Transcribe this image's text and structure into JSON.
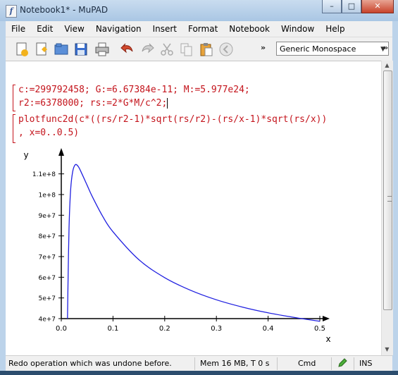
{
  "window": {
    "title": "Notebook1* - MuPAD",
    "app_icon_glyph": "f"
  },
  "menubar": {
    "items": [
      "File",
      "Edit",
      "View",
      "Navigation",
      "Insert",
      "Format",
      "Notebook",
      "Window",
      "Help"
    ]
  },
  "toolbar": {
    "buttons": [
      "new-notebook-icon",
      "new-editor-icon",
      "open-icon",
      "save-icon",
      "print-icon",
      "undo-icon",
      "redo-icon",
      "cut-icon",
      "copy-icon",
      "paste-icon",
      "stop-icon"
    ],
    "overflow_left": "»",
    "font_select": "Generic Monospace",
    "overflow_right": "»"
  },
  "notebook": {
    "input1": {
      "line1": "c:=299792458; G:=6.67384e-11; M:=5.977e24;",
      "line2": "r2:=6378000; rs:=2*G*M/c^2;"
    },
    "input2": {
      "line1": "plotfunc2d(c*((rs/r2-1)*sqrt(rs/r2)-(rs/x-1)*sqrt(rs/x))",
      "line2": ", x=0..0.5)"
    }
  },
  "chart_data": {
    "type": "line",
    "xlabel": "x",
    "ylabel": "y",
    "xlim": [
      0,
      0.5
    ],
    "ylim": [
      40000000,
      115000000
    ],
    "x_ticks": [
      "0.0",
      "0.1",
      "0.2",
      "0.3",
      "0.4",
      "0.5"
    ],
    "x_tick_values": [
      0,
      0.1,
      0.2,
      0.3,
      0.4,
      0.5
    ],
    "y_ticks": [
      "4e+7",
      "5e+7",
      "6e+7",
      "7e+7",
      "8e+7",
      "9e+7",
      "1e+8",
      "1.1e+8"
    ],
    "y_tick_values": [
      40000000,
      50000000,
      60000000,
      70000000,
      80000000,
      90000000,
      100000000,
      110000000
    ],
    "series": [
      {
        "color": "#1f1fe0",
        "x": [
          0.012,
          0.013,
          0.015,
          0.018,
          0.022,
          0.027,
          0.033,
          0.04,
          0.05,
          0.06,
          0.08,
          0.1,
          0.15,
          0.2,
          0.25,
          0.3,
          0.35,
          0.4,
          0.45,
          0.5
        ],
        "y": [
          40000000,
          57000000,
          84000000,
          102000000,
          111000000,
          114400000,
          113500000,
          110000000,
          104500000,
          99000000,
          89500000,
          82000000,
          68500000,
          59800000,
          53700000,
          49100000,
          45600000,
          42800000,
          40600000,
          38700000
        ]
      }
    ]
  },
  "statusbar": {
    "message": "Redo operation which was undone before.",
    "memory": "Mem 16 MB, T 0 s",
    "mode": "Cmd",
    "insert": "INS"
  },
  "colors": {
    "input_text": "#c4141c",
    "curve": "#1f1fe0"
  }
}
